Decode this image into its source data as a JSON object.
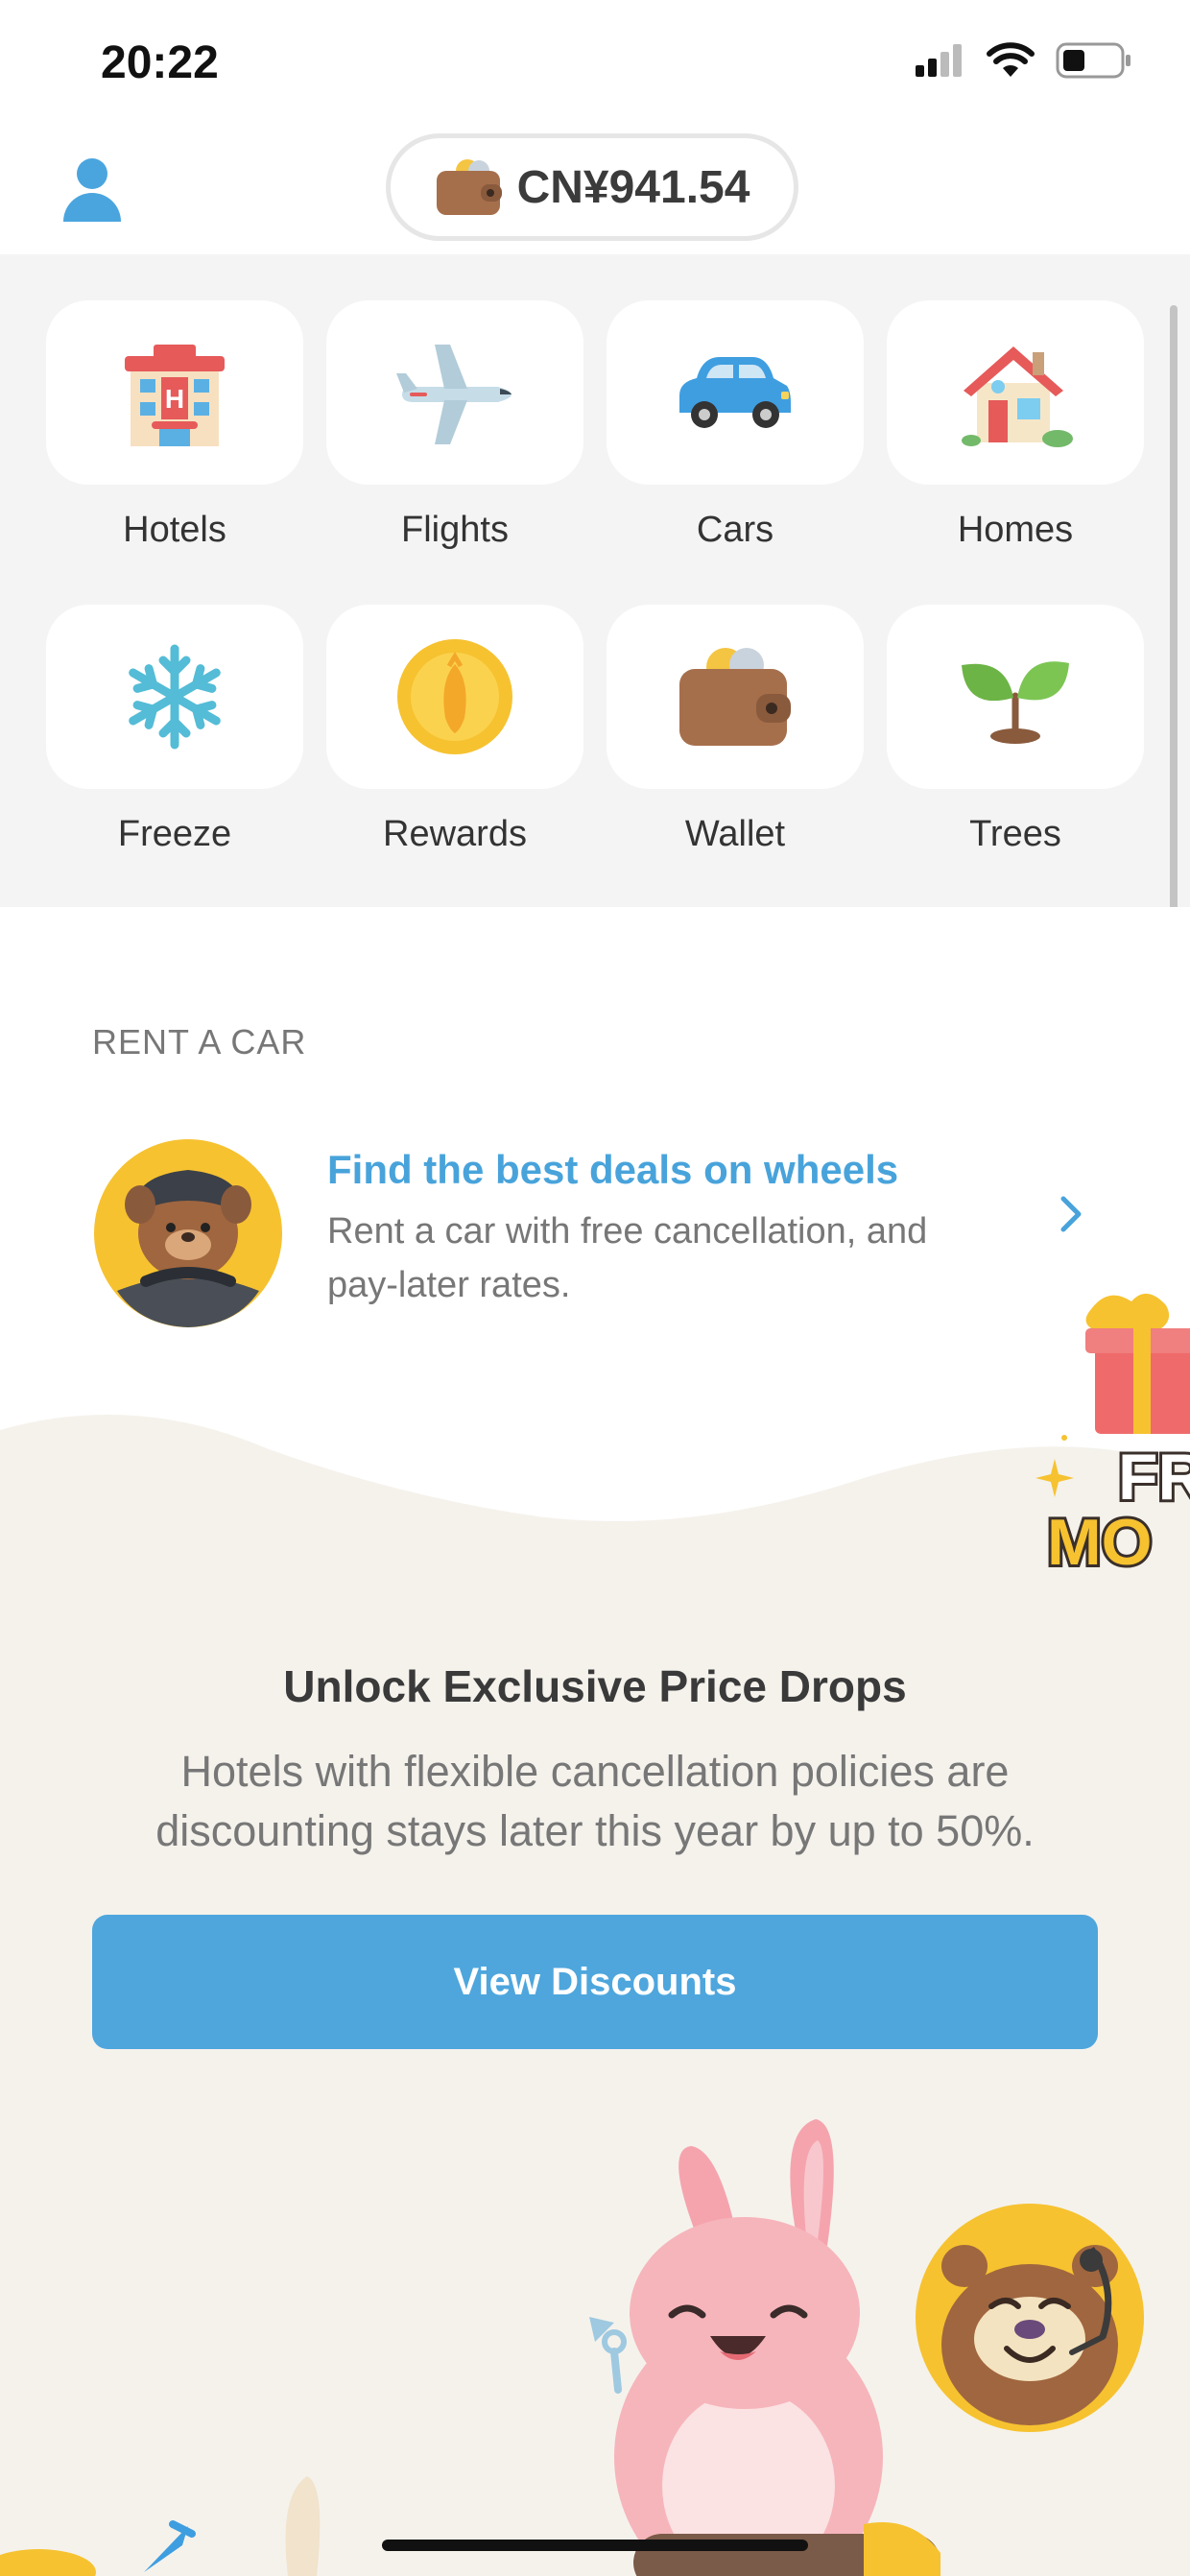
{
  "status_bar": {
    "time": "20:22"
  },
  "header": {
    "balance": "CN¥941.54"
  },
  "grid": [
    {
      "label": "Hotels",
      "icon": "hotel-icon"
    },
    {
      "label": "Flights",
      "icon": "airplane-icon"
    },
    {
      "label": "Cars",
      "icon": "car-icon"
    },
    {
      "label": "Homes",
      "icon": "house-icon"
    },
    {
      "label": "Freeze",
      "icon": "snowflake-icon"
    },
    {
      "label": "Rewards",
      "icon": "coin-icon"
    },
    {
      "label": "Wallet",
      "icon": "wallet-icon"
    },
    {
      "label": "Trees",
      "icon": "sprout-icon"
    }
  ],
  "rent": {
    "heading": "RENT A CAR",
    "title": "Find the best deals on wheels",
    "description": "Rent a car with free cancellation, and pay-later rates."
  },
  "promo": {
    "title": "Unlock Exclusive Price Drops",
    "description": "Hotels with flexible cancellation policies are discounting stays later this year by up to 50%.",
    "button": "View Discounts",
    "sticker_text": "FREE MONEY"
  },
  "colors": {
    "accent": "#48a3db",
    "button": "#4ea6dd",
    "grid_background": "#f4f4f4",
    "promo_background": "#f5f2ec"
  }
}
